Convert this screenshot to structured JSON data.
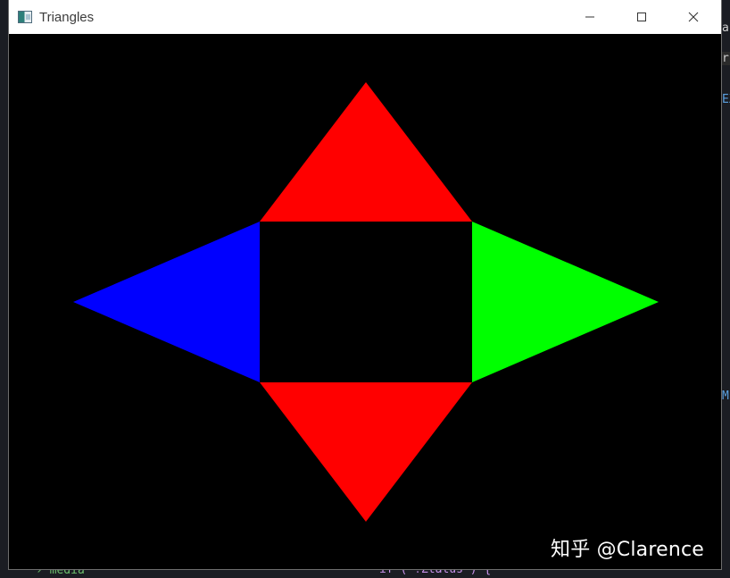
{
  "window": {
    "title": "Triangles",
    "icon": "app-window-icon",
    "controls": {
      "minimize": "minimize-icon",
      "maximize": "maximize-icon",
      "close": "close-icon"
    }
  },
  "scene": {
    "background_color": "#000000",
    "triangles": [
      {
        "name": "triangle-top",
        "color": "#ff0000"
      },
      {
        "name": "triangle-bottom",
        "color": "#ff0000"
      },
      {
        "name": "triangle-left",
        "color": "#0000ff"
      },
      {
        "name": "triangle-right",
        "color": "#00ff00"
      }
    ]
  },
  "watermark": {
    "text": "知乎 @Clarence"
  },
  "background_editor": {
    "fragments": [
      "a",
      "ri",
      "EX",
      "ME",
      "› media",
      "if ( !Ztatus ) {"
    ]
  }
}
